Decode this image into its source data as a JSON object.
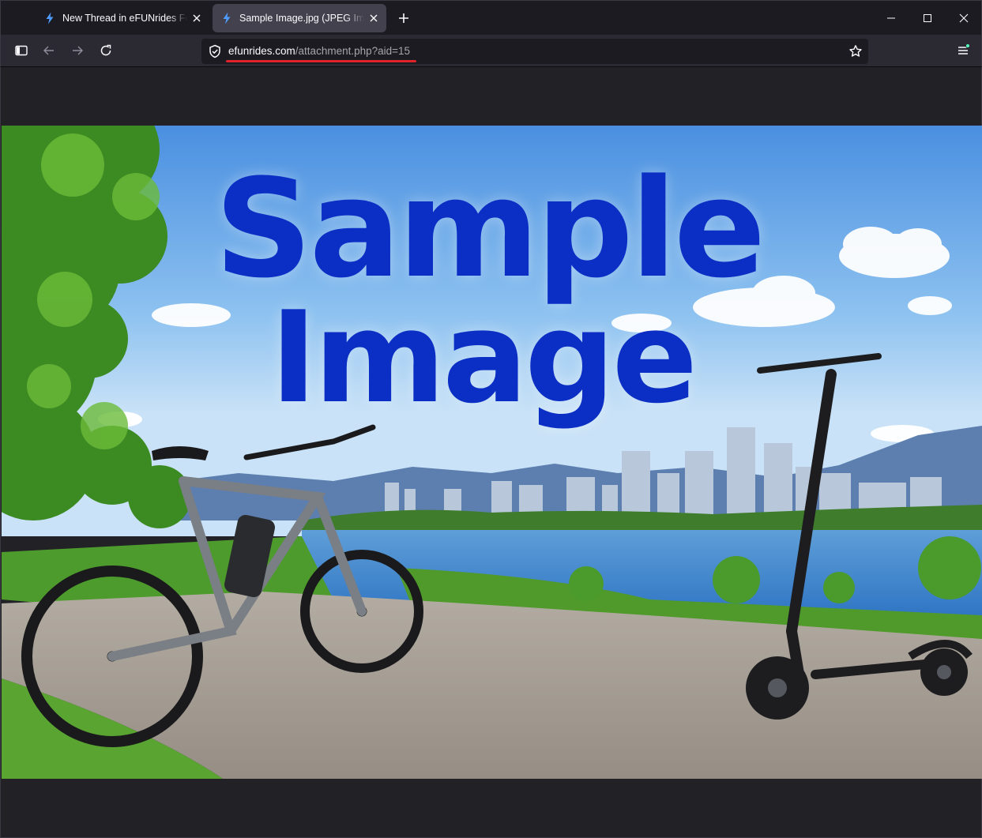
{
  "tabs": [
    {
      "title": "New Thread in eFUNrides Forum",
      "active": false,
      "icon": "bolt-icon"
    },
    {
      "title": "Sample Image.jpg (JPEG Image",
      "active": true,
      "icon": "bolt-icon"
    }
  ],
  "new_tab_icon": "plus-icon",
  "window_controls": [
    "minimize-icon",
    "maximize-icon",
    "close-icon"
  ],
  "toolbar": {
    "sidebar_icon": "sidebar-icon",
    "back_icon": "back-arrow-icon",
    "forward_icon": "forward-arrow-icon",
    "reload_icon": "reload-icon",
    "menu_icon": "menu-icon"
  },
  "urlbar": {
    "host": "efunrides.com",
    "path": "/attachment.php?aid=15",
    "security_icon": "shield-icon",
    "bookmark_icon": "star-icon"
  },
  "image": {
    "text_line1": "Sample",
    "text_line2": "Image"
  },
  "colors": {
    "accent_blue": "#4e9cff",
    "underline_red": "#e0222b",
    "text_blue": "#0b2fc4"
  }
}
